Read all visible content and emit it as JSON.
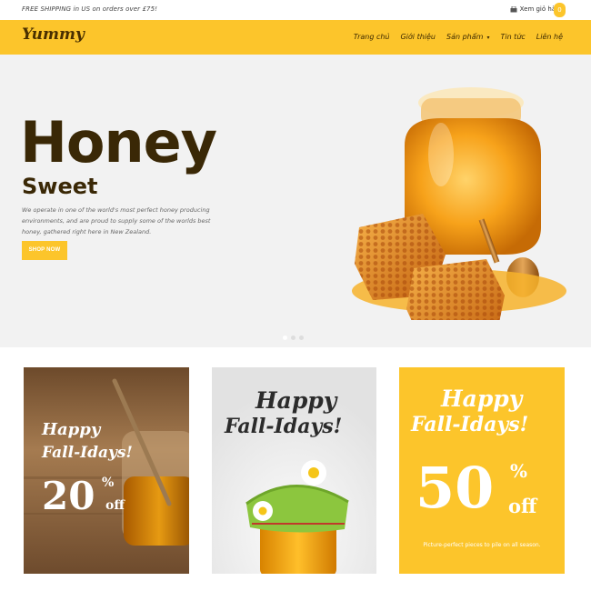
{
  "topbar": {
    "shipping": "FREE SHIPPING in US on orders over £75!",
    "cart_label": "Xem giỏ hàng",
    "cart_count": "0",
    "cart_icon": "basket-icon"
  },
  "header": {
    "logo": "Yummy",
    "nav": [
      "Trang chủ",
      "Giới thiệu",
      "Sản phẩm",
      "Tin tức",
      "Liên hệ"
    ],
    "nav_caret": "▾"
  },
  "hero": {
    "title": "Honey",
    "subtitle": "Sweet",
    "description": "We operate in one of the world's most perfect honey producing environments, and are proud to supply some of the worlds best honey, gathered right here in New Zealand.",
    "button": "SHOP NOW",
    "slides": 3,
    "active_slide": 1
  },
  "promos": [
    {
      "line1": "Happy",
      "line2": "Fall-Idays!",
      "percent": "20",
      "pct_sign": "%",
      "off": "off"
    },
    {
      "line1": "Happy",
      "line2": "Fall-Idays!"
    },
    {
      "line1": "Happy",
      "line2": "Fall-Idays!",
      "percent": "50",
      "pct_sign": "%",
      "off": "off",
      "caption": "Picture-perfect pieces to pile on all season."
    }
  ],
  "colors": {
    "accent": "#fcc52b",
    "brown": "#3a2806",
    "hero_bg": "#f2f2f2"
  }
}
